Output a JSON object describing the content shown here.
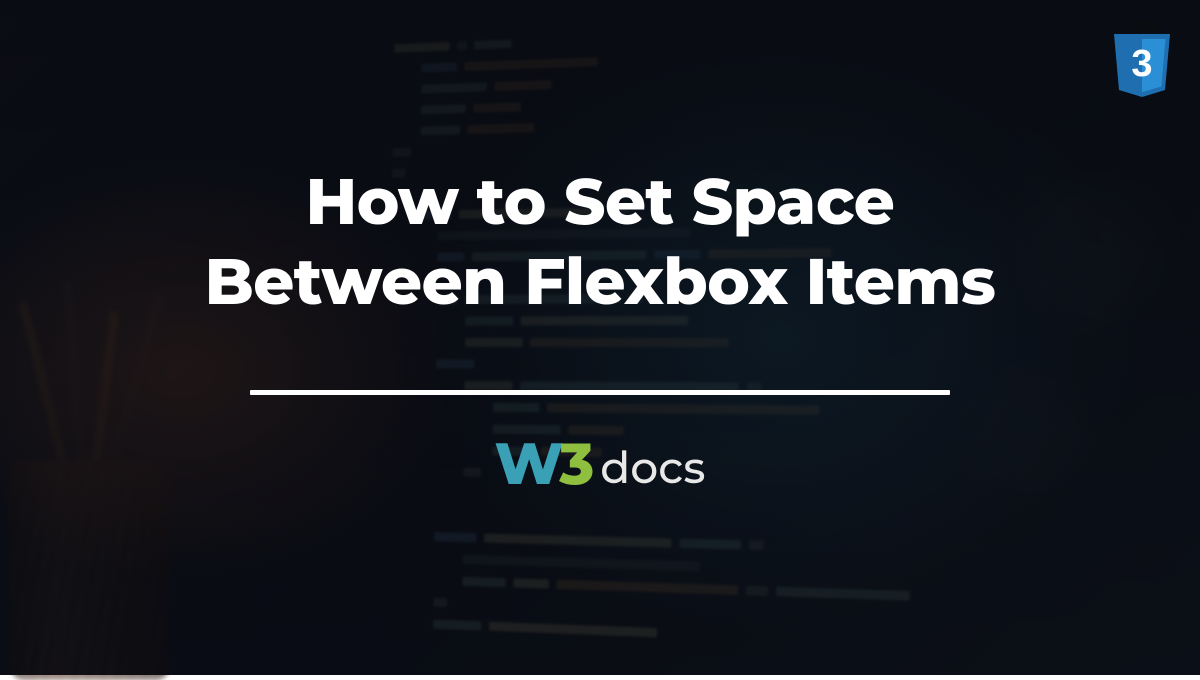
{
  "title_line1": "How to Set Space",
  "title_line2": "Between Flexbox Items",
  "logo": {
    "w": "W",
    "three": "3",
    "docs": "docs"
  },
  "badge": {
    "name": "css3-badge",
    "label": "CSS",
    "number": "3",
    "shield_color": "#1f6fb0",
    "shield_light": "#2a8fd4"
  },
  "colors": {
    "title": "#ffffff",
    "divider": "#ffffff",
    "logo_w": "#3aa0b5",
    "logo_3": "#8fbf3f",
    "logo_docs": "#e8e8e8"
  }
}
